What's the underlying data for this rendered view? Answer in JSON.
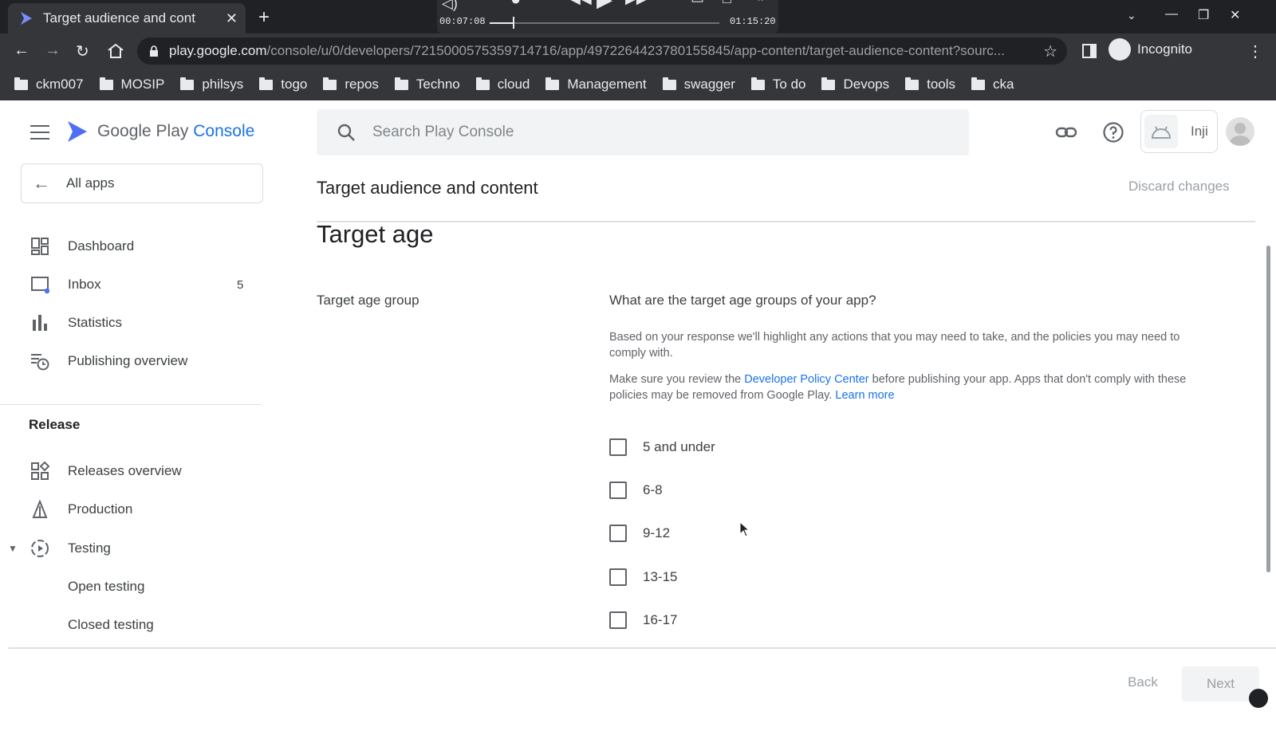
{
  "browser": {
    "tab_title": "Target audience and cont",
    "new_tab": "+",
    "url_host": "play.google.com",
    "url_path": "/console/u/0/developers/7215000575359714716/app/4972264423780155845/app-content/target-audience-content?sourc...",
    "incognito_label": "Incognito",
    "media": {
      "elapsed": "00:07:08",
      "total": "01:15:20",
      "progress": 0.1
    },
    "bookmarks": [
      "ckm007",
      "MOSIP",
      "philsys",
      "togo",
      "repos",
      "Techno",
      "cloud",
      "Management",
      "swagger",
      "To do",
      "Devops",
      "tools",
      "cka"
    ]
  },
  "console": {
    "logo_prefix": "Google Play ",
    "logo_accent": "Console",
    "search_placeholder": "Search Play Console",
    "app_name": "Inji",
    "all_apps": "All apps",
    "nav": [
      {
        "label": "Dashboard",
        "icon": "dashboard-icon"
      },
      {
        "label": "Inbox",
        "icon": "inbox-icon",
        "count": "5"
      },
      {
        "label": "Statistics",
        "icon": "statistics-icon"
      },
      {
        "label": "Publishing overview",
        "icon": "publishing-overview-icon"
      }
    ],
    "release_heading": "Release",
    "release_nav": [
      {
        "label": "Releases overview",
        "icon": "releases-overview-icon"
      },
      {
        "label": "Production",
        "icon": "production-icon"
      },
      {
        "label": "Testing",
        "icon": "testing-icon"
      },
      {
        "label": "Open testing"
      },
      {
        "label": "Closed testing"
      }
    ]
  },
  "main": {
    "page_title": "Target audience and content",
    "discard": "Discard changes",
    "section_title": "Target age",
    "field_label": "Target age group",
    "question": "What are the target age groups of your app?",
    "helper1": "Based on your response we'll highlight any actions that you may need to take, and the policies you may need to comply with.",
    "helper2_before": "Make sure you review the ",
    "helper2_link": "Developer Policy Center",
    "helper2_after": " before publishing your app. Apps that don't comply with these policies may be removed from Google Play. ",
    "helper2_learn": "Learn more",
    "options": [
      "5 and under",
      "6-8",
      "9-12",
      "13-15",
      "16-17"
    ],
    "back": "Back",
    "next": "Next"
  },
  "colors": {
    "accent": "#1a73e8",
    "play_logo": "#4f6ef7"
  }
}
